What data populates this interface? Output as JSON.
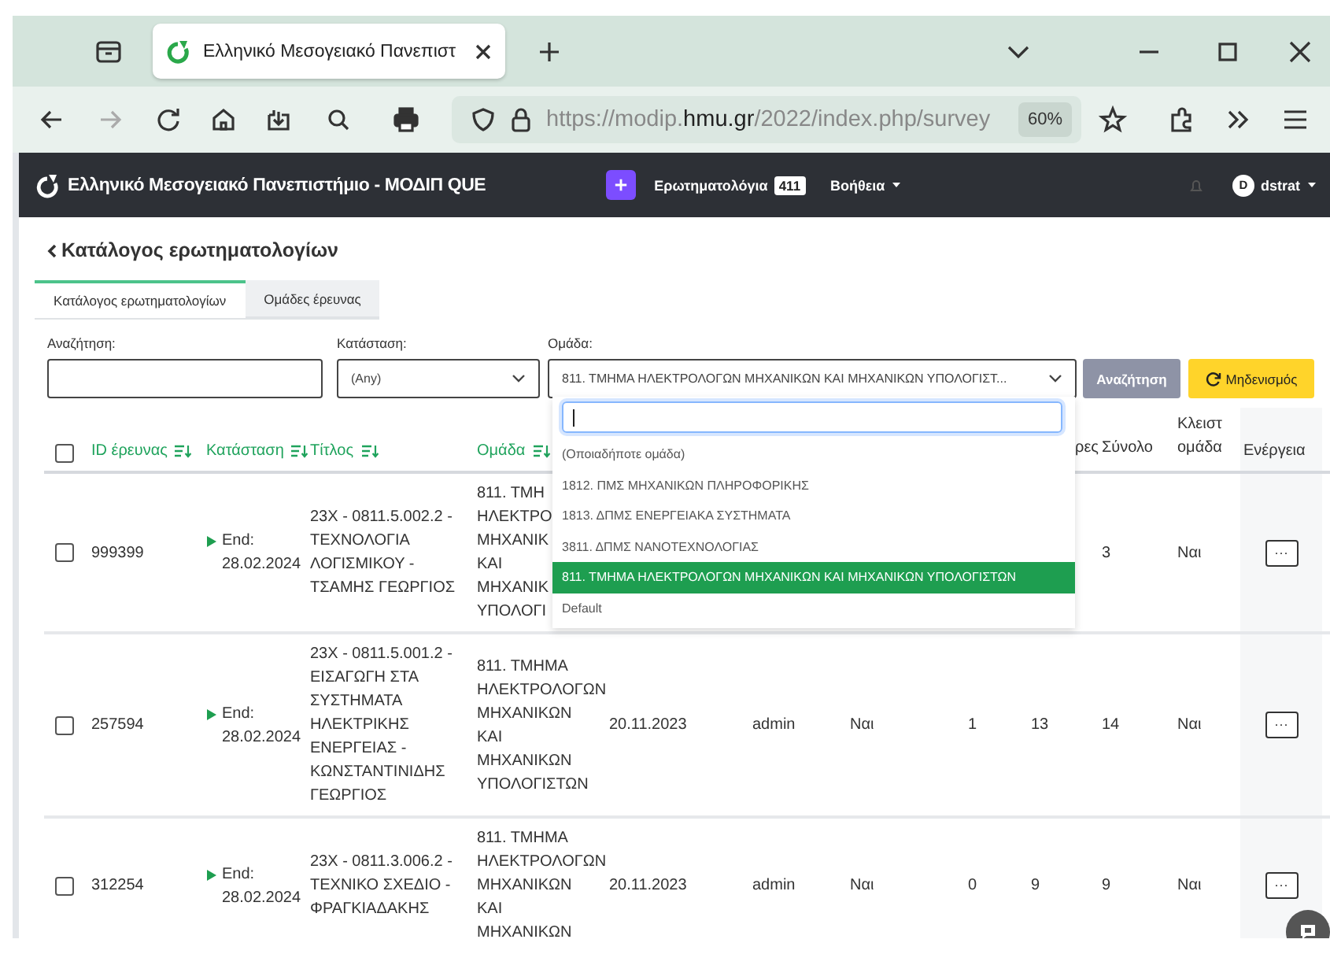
{
  "browser": {
    "tab": {
      "title": "Ελληνικό Μεσογειακό Πανεπιστ"
    },
    "url_parts": [
      {
        "text": "https://modip.",
        "highlight": false
      },
      {
        "text": "hmu.gr",
        "highlight": true
      },
      {
        "text": "/2022/index.php/survey",
        "highlight": false
      }
    ],
    "zoom": "60%"
  },
  "header": {
    "title": "Ελληνικό Μεσογειακό Πανεπιστήμιο - ΜΟΔΙΠ QUE",
    "nav": [
      {
        "label": "Ερωτηματολόγια",
        "badge": "411",
        "dropdown": false
      },
      {
        "label": "Βοήθεια",
        "dropdown": true
      }
    ],
    "user": {
      "initial": "D",
      "name": "dstrat"
    }
  },
  "back_link": "Κατάλογος ερωτηματολογίων",
  "tabs": [
    {
      "label": "Κατάλογος ερωτηματολογίων",
      "selected": true
    },
    {
      "label": "Ομάδες έρευνας",
      "selected": false
    }
  ],
  "filters": {
    "search": {
      "label": "Αναζήτηση:"
    },
    "status": {
      "label": "Κατάσταση:",
      "value": "(Any)"
    },
    "group": {
      "label": "Ομάδα:",
      "value": "811. ΤΜΗΜΑ ΗΛΕΚΤΡΟΛΟΓΩΝ ΜΗΧΑΝΙΚΩΝ ΚΑΙ ΜΗΧΑΝΙΚΩΝ ΥΠΟΛΟΓΙΣΤ...",
      "expanded": true,
      "options": [
        {
          "label": "(Οποιαδήποτε ομάδα)",
          "selected": false
        },
        {
          "label": "1812. ΠΜΣ ΜΗΧΑΝΙΚΩΝ ΠΛΗΡΟΦΟΡΙΚΗΣ",
          "selected": false
        },
        {
          "label": "1813. ΔΠΜΣ ΕΝΕΡΓΕΙΑΚΑ ΣΥΣΤΗΜΑΤΑ",
          "selected": false
        },
        {
          "label": "3811. ΔΠΜΣ ΝΑΝΟΤΕΧΝΟΛΟΓΙΑΣ",
          "selected": false
        },
        {
          "label": "811. ΤΜΗΜΑ ΗΛΕΚΤΡΟΛΟΓΩΝ ΜΗΧΑΝΙΚΩΝ ΚΑΙ ΜΗΧΑΝΙΚΩΝ ΥΠΟΛΟΓΙΣΤΩΝ",
          "selected": true
        },
        {
          "label": "Default",
          "selected": false
        }
      ]
    },
    "search_button": "Αναζήτηση",
    "reset_button": "Μηδενισμός"
  },
  "table": {
    "select_all": {
      "checked": false
    },
    "columns": [
      {
        "kind": "id",
        "label": "ID έρευνας",
        "sortable": true
      },
      {
        "kind": "status",
        "label": "Κατάσταση",
        "sortable": true
      },
      {
        "kind": "text",
        "label": "Τίτλος",
        "sortable": true
      },
      {
        "kind": "text",
        "label": "Ομάδα",
        "sortable": true
      },
      {
        "kind": "text"
      },
      {
        "kind": "text"
      },
      {
        "kind": "text"
      },
      {
        "kind": "text"
      },
      {
        "kind": "text",
        "label": "ρες",
        "sortable": false
      },
      {
        "kind": "text",
        "label": "Σύνολο",
        "sortable": false
      },
      {
        "kind": "text",
        "label": "Κλειστ ομάδα",
        "sortable": false
      },
      {
        "kind": "action",
        "label": "Ενέργεια",
        "sortable": false
      }
    ],
    "rows": [
      {
        "checked": false,
        "cells": [
          "999399",
          "End: 28.02.2024",
          "23X - 0811.5.002.2 - ΤΕΧΝΟΛΟΓΙΑ ΛΟΓΙΣΜΙΚΟΥ - ΤΣΑΜΗΣ ΓΕΩΡΓΙΟΣ",
          [
            "811. ΤΜΗ",
            "ΗΛΕΚΤΡΟ",
            "ΜΗΧΑΝΙΚ",
            "ΚΑΙ",
            "ΜΗΧΑΝΙΚ",
            "ΥΠΟΛΟΓΙ"
          ],
          null,
          null,
          null,
          null,
          null,
          "3",
          "Ναι",
          "···"
        ]
      },
      {
        "checked": false,
        "cells": [
          "257594",
          "End: 28.02.2024",
          "23X - 0811.5.001.2 - ΕΙΣΑΓΩΓΗ ΣΤΑ ΣΥΣΤΗΜΑΤΑ ΗΛΕΚΤΡΙΚΗΣ ΕΝΕΡΓΕΙΑΣ - ΚΩΝΣΤΑΝΤΙΝΙΔΗΣ ΓΕΩΡΓΙΟΣ",
          "811. ΤΜΗΜΑ ΗΛΕΚΤΡΟΛΟΓΩΝ ΜΗΧΑΝΙΚΩΝ ΚΑΙ ΜΗΧΑΝΙΚΩΝ ΥΠΟΛΟΓΙΣΤΩΝ",
          "20.11.2023",
          "admin",
          "Ναι",
          "1",
          "13",
          "14",
          "Ναι",
          "···"
        ]
      },
      {
        "checked": false,
        "cells": [
          "312254",
          "End: 28.02.2024",
          "23X - 0811.3.006.2 - ΤΕΧΝΙΚΟ ΣΧΕΔΙΟ - ΦΡΑΓΚΙΑΔΑΚΗΣ",
          "811. ΤΜΗΜΑ ΗΛΕΚΤΡΟΛΟΓΩΝ ΜΗΧΑΝΙΚΩΝ ΚΑΙ ΜΗΧΑΝΙΚΩΝ",
          "20.11.2023",
          "admin",
          "Ναι",
          "0",
          "9",
          "9",
          "Ναι",
          "···"
        ]
      }
    ]
  }
}
